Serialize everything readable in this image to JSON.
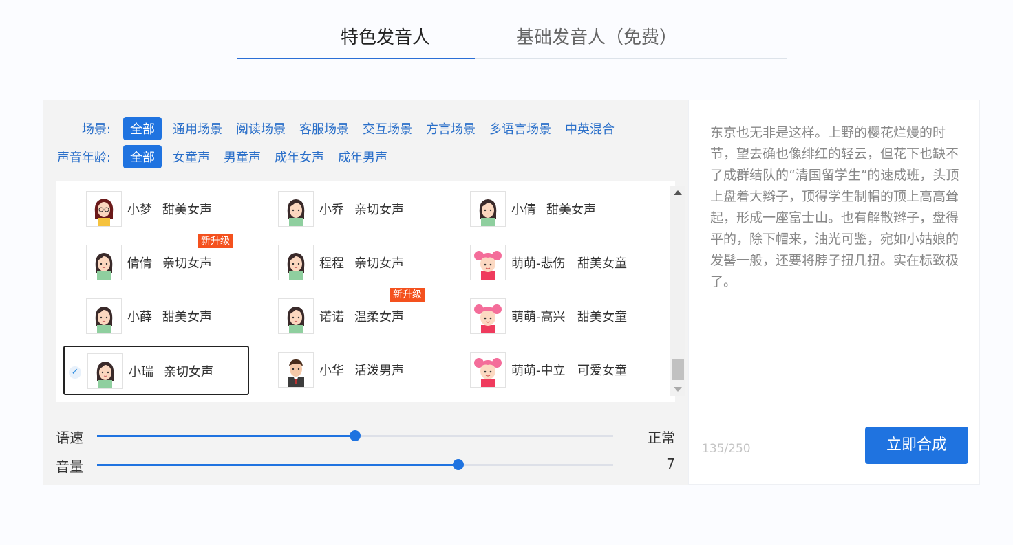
{
  "tabs": {
    "featured": "特色发音人",
    "basic": "基础发音人（免费）"
  },
  "filters": {
    "scene_label": "场景:",
    "scenes": [
      "全部",
      "通用场景",
      "阅读场景",
      "客服场景",
      "交互场景",
      "方言场景",
      "多语言场景",
      "中英混合"
    ],
    "age_label": "声音年龄:",
    "ages": [
      "全部",
      "女童声",
      "男童声",
      "成年女声",
      "成年男声"
    ]
  },
  "voices": [
    {
      "name": "小梦",
      "desc": "甜美女声",
      "avatar": "woman-glasses-avatar"
    },
    {
      "name": "小乔",
      "desc": "亲切女声",
      "avatar": "woman-avatar"
    },
    {
      "name": "小倩",
      "desc": "甜美女声",
      "avatar": "woman-avatar"
    },
    {
      "name": "倩倩",
      "desc": "亲切女声",
      "avatar": "woman-avatar",
      "badge": "新升级"
    },
    {
      "name": "程程",
      "desc": "亲切女声",
      "avatar": "woman-avatar"
    },
    {
      "name": "萌萌-悲伤",
      "desc": "甜美女童",
      "avatar": "girl-avatar"
    },
    {
      "name": "小薛",
      "desc": "甜美女声",
      "avatar": "woman-avatar"
    },
    {
      "name": "诺诺",
      "desc": "温柔女声",
      "avatar": "woman-avatar",
      "badge": "新升级"
    },
    {
      "name": "萌萌-高兴",
      "desc": "甜美女童",
      "avatar": "girl-avatar"
    },
    {
      "name": "小瑞",
      "desc": "亲切女声",
      "avatar": "woman-avatar",
      "selected": true
    },
    {
      "name": "小华",
      "desc": "活泼男声",
      "avatar": "man-avatar"
    },
    {
      "name": "萌萌-中立",
      "desc": "可爱女童",
      "avatar": "girl-avatar"
    }
  ],
  "sliders": {
    "speed": {
      "label": "语速",
      "value_text": "正常",
      "level": 0.5
    },
    "volume": {
      "label": "音量",
      "value_text": "7",
      "level": 0.7
    }
  },
  "text": {
    "content": "东京也无非是这样。上野的樱花烂熳的时节，望去确也像绯红的轻云，但花下也缺不了成群结队的“清国留学生”的速成班，头顶上盘着大辫子，顶得学生制帽的顶上高高耸起，形成一座富士山。也有解散辫子，盘得平的，除下帽来，油光可鉴，宛如小姑娘的发髻一般，还要将脖子扭几扭。实在标致极了。",
    "count": "135/250"
  },
  "actions": {
    "synthesize": "立即合成"
  },
  "colors": {
    "accent": "#1f73e0",
    "badge": "#f4511e"
  }
}
